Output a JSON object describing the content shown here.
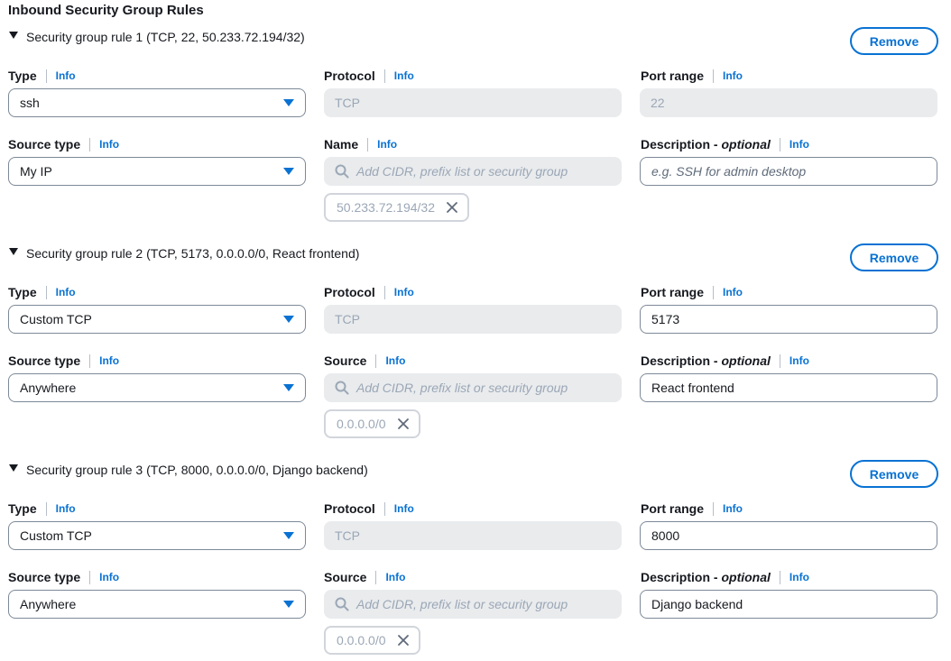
{
  "section_title": "Inbound Security Group Rules",
  "labels": {
    "type": "Type",
    "protocol": "Protocol",
    "port_range": "Port range",
    "source_type": "Source type",
    "description_prefix": "Description - ",
    "description_suffix": "optional",
    "info": "Info",
    "remove": "Remove"
  },
  "rules": [
    {
      "title": "Security group rule 1 (TCP, 22, 50.233.72.194/32)",
      "type": "ssh",
      "protocol": "TCP",
      "port_range": "22",
      "port_editable": false,
      "source_type": "My IP",
      "source_label": "Name",
      "source_placeholder": "Add CIDR, prefix list or security group",
      "source_token": "50.233.72.194/32",
      "description_value": "",
      "description_placeholder": "e.g. SSH for admin desktop"
    },
    {
      "title": "Security group rule 2 (TCP, 5173, 0.0.0.0/0, React frontend)",
      "type": "Custom TCP",
      "protocol": "TCP",
      "port_range": "5173",
      "port_editable": true,
      "source_type": "Anywhere",
      "source_label": "Source",
      "source_placeholder": "Add CIDR, prefix list or security group",
      "source_token": "0.0.0.0/0",
      "description_value": "React frontend",
      "description_placeholder": ""
    },
    {
      "title": "Security group rule 3 (TCP, 8000, 0.0.0.0/0, Django backend)",
      "type": "Custom TCP",
      "protocol": "TCP",
      "port_range": "8000",
      "port_editable": true,
      "source_type": "Anywhere",
      "source_label": "Source",
      "source_placeholder": "Add CIDR, prefix list or security group",
      "source_token": "0.0.0.0/0",
      "description_value": "Django backend",
      "description_placeholder": ""
    }
  ],
  "colors": {
    "link": "#0972d3",
    "disabled_bg": "#e9ebed",
    "disabled_text": "#9ba7b6",
    "border": "#7d8998"
  }
}
